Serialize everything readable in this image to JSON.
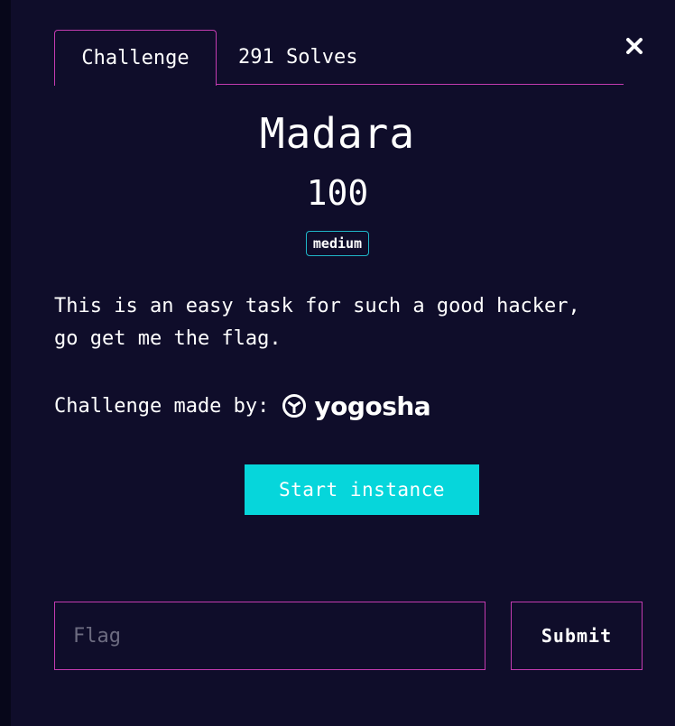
{
  "tabs": {
    "challenge_label": "Challenge",
    "solves_label": "291 Solves"
  },
  "close_icon": "close-icon",
  "challenge": {
    "title": "Madara",
    "points": "100",
    "difficulty": "medium",
    "description": "This is an easy task for such a good hacker,\ngo get me the flag.",
    "author_label": "Challenge made by:",
    "author_logo_text": "yogosha"
  },
  "actions": {
    "start_instance_label": "Start instance"
  },
  "flag_form": {
    "placeholder": "Flag",
    "value": "",
    "submit_label": "Submit"
  },
  "colors": {
    "background": "#0f0d2a",
    "accent_border": "#c33bb0",
    "badge_border": "#1fb6c8",
    "primary_button": "#06d6db"
  }
}
